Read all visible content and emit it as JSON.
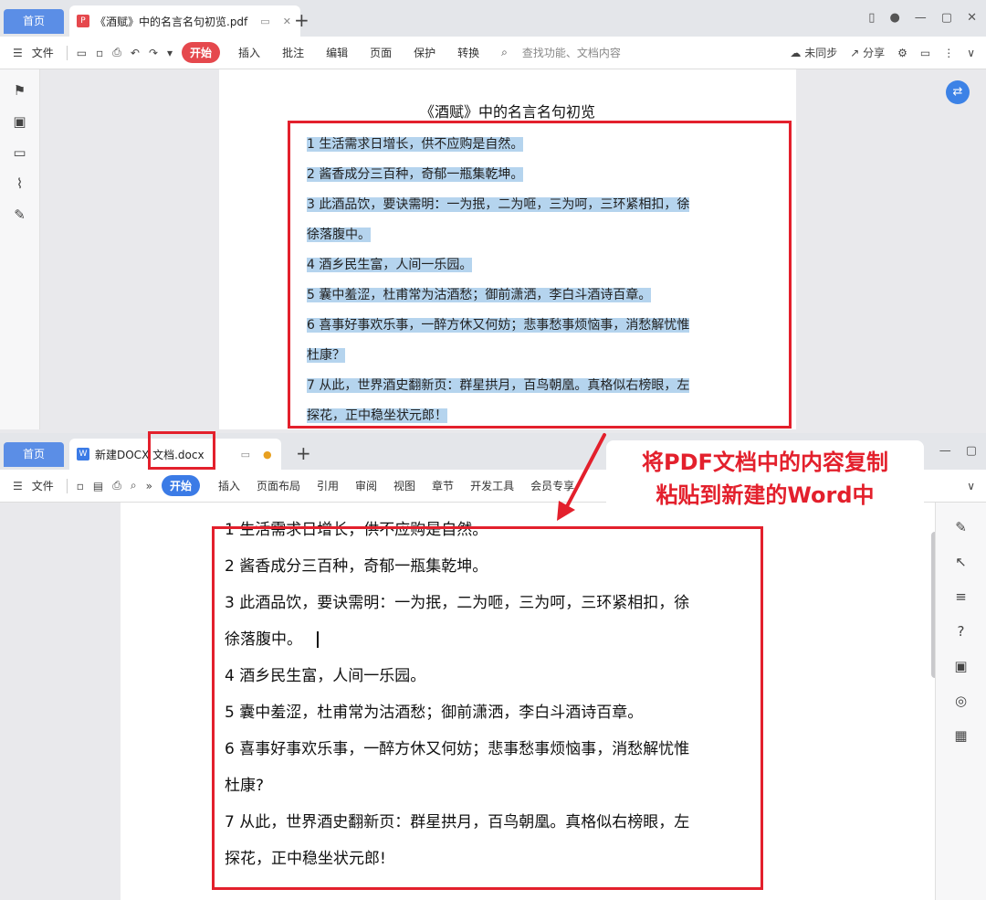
{
  "pdf_window": {
    "home_tab": "首页",
    "doc_tab": "《酒赋》中的名言名句初览.pdf",
    "toolbar": {
      "file": "文件",
      "start": "开始",
      "tabs": [
        "插入",
        "批注",
        "编辑",
        "页面",
        "保护",
        "转换"
      ],
      "search_placeholder": "查找功能、文档内容",
      "sync": "未同步",
      "share": "分享"
    },
    "title": "《酒赋》中的名言名句初览",
    "lines": [
      "1  生活需求日增长，供不应购是自然。",
      "2  酱香成分三百种，奇郁一瓶集乾坤。",
      "3  此酒品饮，要诀需明：一为抿，二为咂，三为呵，三环紧相扣，徐",
      "徐落腹中。",
      "4  酒乡民生富，人间一乐园。",
      "5  囊中羞涩，杜甫常为沽酒愁；御前潇洒，李白斗酒诗百章。",
      "6  喜事好事欢乐事，一醉方休又何妨；悲事愁事烦恼事，消愁解忧惟",
      "杜康？",
      "7  从此，世界酒史翻新页：群星拱月，百鸟朝凰。真格似右榜眼，左",
      "探花，正中稳坐状元郎！"
    ]
  },
  "word_window": {
    "home_tab": "首页",
    "doc_tab": "新建DOCX 文档.docx",
    "toolbar": {
      "file": "文件",
      "start": "开始",
      "tabs": [
        "插入",
        "页面布局",
        "引用",
        "审阅",
        "视图",
        "章节",
        "开发工具",
        "会员专享"
      ]
    },
    "lines": [
      "1  生活需求日增长，供不应购是自然。",
      "2  酱香成分三百种，奇郁一瓶集乾坤。",
      "3  此酒品饮，要诀需明：一为抿，二为咂，三为呵，三环紧相扣，徐",
      "徐落腹中。",
      "4  酒乡民生富，人间一乐园。",
      "5  囊中羞涩，杜甫常为沽酒愁；御前潇洒，李白斗酒诗百章。",
      "6  喜事好事欢乐事，一醉方休又何妨；悲事愁事烦恼事，消愁解忧惟",
      "杜康?",
      "7  从此，世界酒史翻新页：群星拱月，百鸟朝凰。真格似右榜眼，左",
      "探花，正中稳坐状元郎!"
    ]
  },
  "callout": {
    "line1": "将PDF文档中的内容复制",
    "line2": "粘贴到新建的Word中"
  },
  "colors": {
    "annotation_red": "#e3202c",
    "pdf_start": "#e5484d",
    "word_start": "#3b7be6",
    "highlight": "#b5d4ee"
  }
}
